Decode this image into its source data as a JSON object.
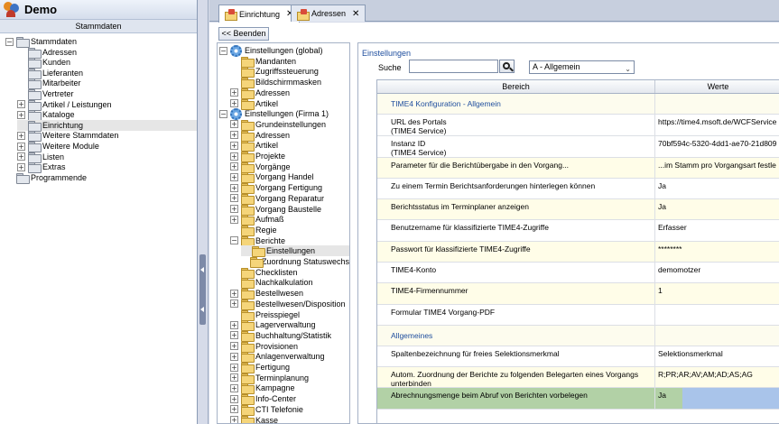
{
  "app": {
    "title": "Demo"
  },
  "nav": {
    "caption": "Stammdaten",
    "items": [
      {
        "label": "Stammdaten",
        "level": 0,
        "expander": "−",
        "icon": "grey"
      },
      {
        "label": "Adressen",
        "level": 1,
        "expander": "",
        "icon": "grey"
      },
      {
        "label": "Kunden",
        "level": 1,
        "expander": "",
        "icon": "grey"
      },
      {
        "label": "Lieferanten",
        "level": 1,
        "expander": "",
        "icon": "grey"
      },
      {
        "label": "Mitarbeiter",
        "level": 1,
        "expander": "",
        "icon": "grey"
      },
      {
        "label": "Vertreter",
        "level": 1,
        "expander": "",
        "icon": "grey"
      },
      {
        "label": "Artikel / Leistungen",
        "level": 1,
        "expander": "+",
        "icon": "grey"
      },
      {
        "label": "Kataloge",
        "level": 1,
        "expander": "+",
        "icon": "grey"
      },
      {
        "label": "Einrichtung",
        "level": 1,
        "expander": "",
        "icon": "grey",
        "selected": true
      },
      {
        "label": "Weitere Stammdaten",
        "level": 1,
        "expander": "+",
        "icon": "grey"
      },
      {
        "label": "Weitere Module",
        "level": 1,
        "expander": "+",
        "icon": "grey"
      },
      {
        "label": "Listen",
        "level": 1,
        "expander": "+",
        "icon": "grey"
      },
      {
        "label": "Extras",
        "level": 1,
        "expander": "+",
        "icon": "grey"
      },
      {
        "label": "Programmende",
        "level": 0,
        "expander": "",
        "icon": "grey"
      }
    ]
  },
  "tabs": [
    {
      "label": "Einrichtung",
      "active": true,
      "close": "✕"
    },
    {
      "label": "Adressen",
      "active": false,
      "close": "✕"
    }
  ],
  "toolbar": {
    "back_label": "<< Beenden"
  },
  "settings_tree": [
    {
      "label": "Einstellungen (global)",
      "level": 0,
      "expander": "−",
      "icon": "gear"
    },
    {
      "label": "Mandanten",
      "level": 1,
      "expander": "",
      "icon": "folder"
    },
    {
      "label": "Zugriffssteuerung",
      "level": 1,
      "expander": "",
      "icon": "folder"
    },
    {
      "label": "Bildschirmmasken",
      "level": 1,
      "expander": "",
      "icon": "folder"
    },
    {
      "label": "Adressen",
      "level": 1,
      "expander": "+",
      "icon": "folder"
    },
    {
      "label": "Artikel",
      "level": 1,
      "expander": "+",
      "icon": "folder"
    },
    {
      "label": "Einstellungen (Firma 1)",
      "level": 0,
      "expander": "−",
      "icon": "gear"
    },
    {
      "label": "Grundeinstellungen",
      "level": 1,
      "expander": "+",
      "icon": "folder"
    },
    {
      "label": "Adressen",
      "level": 1,
      "expander": "+",
      "icon": "folder"
    },
    {
      "label": "Artikel",
      "level": 1,
      "expander": "+",
      "icon": "folder"
    },
    {
      "label": "Projekte",
      "level": 1,
      "expander": "+",
      "icon": "folder"
    },
    {
      "label": "Vorgänge",
      "level": 1,
      "expander": "+",
      "icon": "folder"
    },
    {
      "label": "Vorgang Handel",
      "level": 1,
      "expander": "+",
      "icon": "folder"
    },
    {
      "label": "Vorgang Fertigung",
      "level": 1,
      "expander": "+",
      "icon": "folder"
    },
    {
      "label": "Vorgang Reparatur",
      "level": 1,
      "expander": "+",
      "icon": "folder"
    },
    {
      "label": "Vorgang Baustelle",
      "level": 1,
      "expander": "+",
      "icon": "folder"
    },
    {
      "label": "Aufmaß",
      "level": 1,
      "expander": "+",
      "icon": "folder"
    },
    {
      "label": "Regie",
      "level": 1,
      "expander": "",
      "icon": "folder"
    },
    {
      "label": "Berichte",
      "level": 1,
      "expander": "−",
      "icon": "folder"
    },
    {
      "label": "Einstellungen",
      "level": 2,
      "expander": "",
      "icon": "folder",
      "selected": true
    },
    {
      "label": "Zuordnung Statuswechs",
      "level": 2,
      "expander": "",
      "icon": "folder"
    },
    {
      "label": "Checklisten",
      "level": 1,
      "expander": "",
      "icon": "folder"
    },
    {
      "label": "Nachkalkulation",
      "level": 1,
      "expander": "",
      "icon": "folder"
    },
    {
      "label": "Bestellwesen",
      "level": 1,
      "expander": "+",
      "icon": "folder"
    },
    {
      "label": "Bestellwesen/Disposition",
      "level": 1,
      "expander": "+",
      "icon": "folder"
    },
    {
      "label": "Preisspiegel",
      "level": 1,
      "expander": "",
      "icon": "folder"
    },
    {
      "label": "Lagerverwaltung",
      "level": 1,
      "expander": "+",
      "icon": "folder"
    },
    {
      "label": "Buchhaltung/Statistik",
      "level": 1,
      "expander": "+",
      "icon": "folder"
    },
    {
      "label": "Provisionen",
      "level": 1,
      "expander": "+",
      "icon": "folder"
    },
    {
      "label": "Anlagenverwaltung",
      "level": 1,
      "expander": "+",
      "icon": "folder"
    },
    {
      "label": "Fertigung",
      "level": 1,
      "expander": "+",
      "icon": "folder"
    },
    {
      "label": "Terminplanung",
      "level": 1,
      "expander": "+",
      "icon": "folder"
    },
    {
      "label": "Kampagne",
      "level": 1,
      "expander": "+",
      "icon": "folder"
    },
    {
      "label": "Info-Center",
      "level": 1,
      "expander": "+",
      "icon": "folder"
    },
    {
      "label": "CTI Telefonie",
      "level": 1,
      "expander": "+",
      "icon": "folder"
    },
    {
      "label": "Kasse",
      "level": 1,
      "expander": "+",
      "icon": "folder"
    }
  ],
  "detail": {
    "title": "Einstellungen",
    "search_label": "Suche",
    "search_value": "",
    "category_value": "A - Allgemein",
    "columns": {
      "bereich": "Bereich",
      "werte": "Werte"
    },
    "rows": [
      {
        "type": "group",
        "bereich": "TIME4 Konfiguration - Allgemein",
        "werte": "",
        "h": 23
      },
      {
        "type": "item",
        "bereich": "URL des Portals\n(TIME4 Service)",
        "werte": "https://time4.msoft.de/WCFService",
        "h": 24
      },
      {
        "type": "item",
        "bereich": "Instanz ID\n(TIME4 Service)",
        "werte": "70bf594c-5320-4dd1-ae70-21d809",
        "h": 24
      },
      {
        "type": "item",
        "bereich": "Parameter für die Berichtübergabe in den Vorgang...",
        "werte": "...im Stamm pro Vorgangsart festle",
        "h": 23,
        "alt": true
      },
      {
        "type": "item",
        "bereich": "Zu einem Termin Berichtsanforderungen hinterlegen können",
        "werte": "Ja",
        "h": 23
      },
      {
        "type": "item",
        "bereich": "Berichtsstatus im Terminplaner anzeigen",
        "werte": "Ja",
        "h": 23,
        "alt": true
      },
      {
        "type": "item",
        "bereich": "Benutzername für klassifizierte TIME4-Zugriffe",
        "werte": "Erfasser",
        "h": 24
      },
      {
        "type": "item",
        "bereich": "Passwort für klassifizierte TIME4-Zugriffe",
        "werte": "********",
        "h": 23,
        "alt": true
      },
      {
        "type": "item",
        "bereich": "TIME4-Konto",
        "werte": "demomotzer",
        "h": 23
      },
      {
        "type": "item",
        "bereich": "TIME4-Firmennummer",
        "werte": "1",
        "h": 24,
        "alt": true
      },
      {
        "type": "item",
        "bereich": "Formular TIME4 Vorgang-PDF",
        "werte": "",
        "h": 23
      },
      {
        "type": "group",
        "bereich": "Allgemeines",
        "werte": "",
        "h": 23
      },
      {
        "type": "item",
        "bereich": "Spaltenbezeichnung für freies Selektionsmerkmal",
        "werte": "Selektionsmerkmal",
        "h": 23
      },
      {
        "type": "item",
        "bereich": "Autom. Zuordnung der Berichte zu folgenden Belegarten eines Vorgangs unterbinden",
        "werte": "R;PR;AR;AV;AM;AD;AS;AG",
        "h": 23,
        "alt": true
      },
      {
        "type": "item",
        "bereich": "Abrechnungsmenge beim Abruf von Berichten vorbelegen",
        "werte": "Ja",
        "h": 24,
        "highlight": true
      }
    ]
  }
}
